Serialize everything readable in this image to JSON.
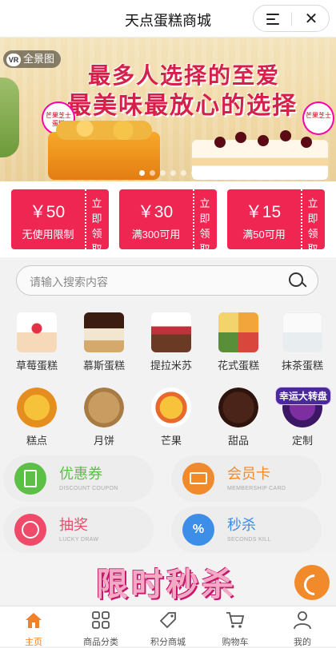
{
  "header": {
    "title": "天点蛋糕商城"
  },
  "banner": {
    "vr_label": "全景图",
    "vr_badge": "VR",
    "line1": "最多人选择的至爱",
    "line2": "最美味最放心的选择",
    "tag_left": "芒果芝士蛋糕",
    "tag_right": "芒果芝士"
  },
  "coupons": [
    {
      "amount": "￥50",
      "condition": "无使用限制",
      "action": "立即领取"
    },
    {
      "amount": "￥30",
      "condition": "满300可用",
      "action": "立即领取"
    },
    {
      "amount": "￥15",
      "condition": "满50可用",
      "action": "立即领取"
    }
  ],
  "search": {
    "placeholder": "请输入搜索内容"
  },
  "categories": [
    {
      "label": "草莓蛋糕"
    },
    {
      "label": "慕斯蛋糕"
    },
    {
      "label": "提拉米苏"
    },
    {
      "label": "花式蛋糕"
    },
    {
      "label": "抹茶蛋糕"
    },
    {
      "label": "糕点"
    },
    {
      "label": "月饼"
    },
    {
      "label": "芒果"
    },
    {
      "label": "甜品"
    },
    {
      "label": "定制"
    }
  ],
  "lucky_wheel": {
    "label": "幸运大转盘"
  },
  "features": [
    {
      "name": "优惠券",
      "sub": "DISCOUNT COUPON",
      "color": "#5cbf46"
    },
    {
      "name": "会员卡",
      "sub": "MEMBERSHIP CARD",
      "color": "#f08a2a"
    },
    {
      "name": "抽奖",
      "sub": "LUCKY DRAW",
      "color": "#ef4a6a"
    },
    {
      "name": "秒杀",
      "sub": "SECONDS KILL",
      "color": "#3d8ee8"
    }
  ],
  "promo": {
    "text": "限时秒杀"
  },
  "tabs": [
    {
      "label": "主页"
    },
    {
      "label": "商品分类"
    },
    {
      "label": "积分商城"
    },
    {
      "label": "购物车"
    },
    {
      "label": "我的"
    }
  ],
  "colors": {
    "accent": "#f0802a",
    "coupon": "#f02652"
  }
}
